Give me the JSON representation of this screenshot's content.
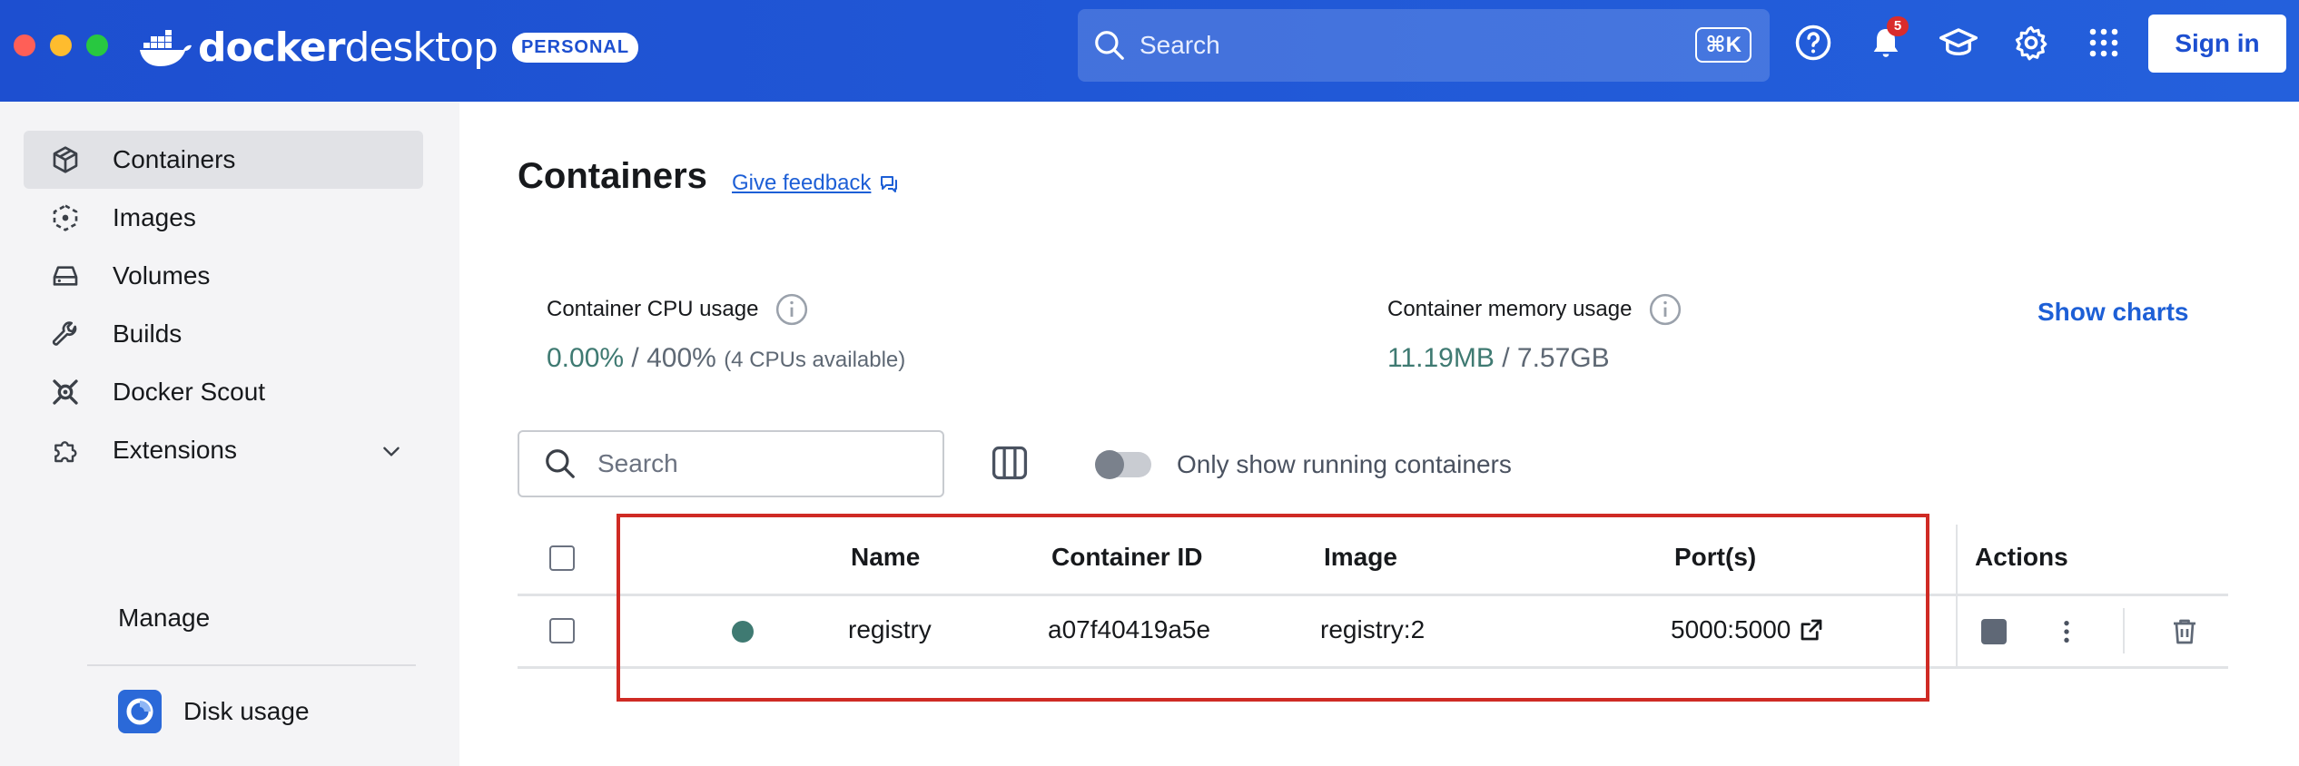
{
  "app": {
    "logo_word_bold": "docker",
    "logo_word_light": "desktop",
    "plan_badge": "PERSONAL",
    "search_placeholder": "Search",
    "search_shortcut": "⌘K",
    "notification_count": "5",
    "sign_in_label": "Sign in",
    "accent_color": "#1d4fd0"
  },
  "sidebar": {
    "items": [
      {
        "label": "Containers",
        "icon": "container-icon",
        "active": true
      },
      {
        "label": "Images",
        "icon": "image-icon"
      },
      {
        "label": "Volumes",
        "icon": "volume-icon"
      },
      {
        "label": "Builds",
        "icon": "wrench-icon"
      },
      {
        "label": "Docker Scout",
        "icon": "scout-icon"
      },
      {
        "label": "Extensions",
        "icon": "puzzle-icon"
      }
    ],
    "manage_label": "Manage",
    "disk_usage_label": "Disk usage"
  },
  "main": {
    "title": "Containers",
    "feedback_link": "Give feedback",
    "cpu": {
      "label": "Container CPU usage",
      "used": "0.00%",
      "separator": "/",
      "total": "400%",
      "note": "(4 CPUs available)"
    },
    "memory": {
      "label": "Container memory usage",
      "used": "11.19MB",
      "separator": "/",
      "total": "7.57GB"
    },
    "show_charts_label": "Show charts",
    "search_placeholder": "Search",
    "running_toggle_label": "Only show running containers",
    "running_toggle_on": false,
    "table": {
      "headers": {
        "name": "Name",
        "container_id": "Container ID",
        "image": "Image",
        "ports": "Port(s)",
        "actions": "Actions"
      },
      "rows": [
        {
          "status": "running",
          "name": "registry",
          "container_id": "a07f40419a5e",
          "image": "registry:2",
          "ports": "5000:5000"
        }
      ]
    }
  }
}
